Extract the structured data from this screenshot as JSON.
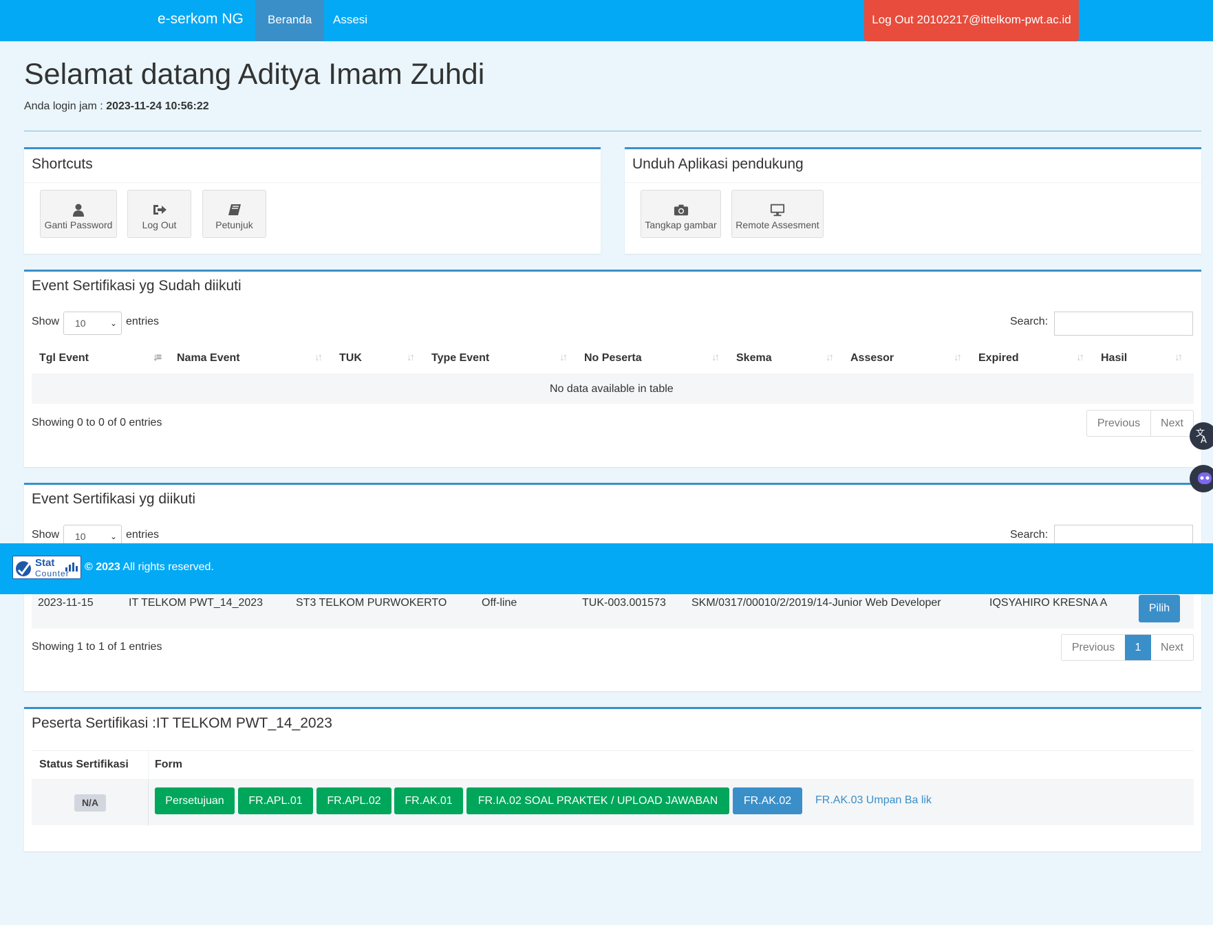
{
  "navbar": {
    "brand": "e-serkom NG",
    "links": [
      "Beranda",
      "Assesi"
    ],
    "logout": "Log Out 20102217@ittelkom-pwt.ac.id"
  },
  "header": {
    "welcome": "Selamat datang Aditya Imam Zuhdi",
    "login_label": "Anda login jam : ",
    "login_time": "2023-11-24 10:56:22"
  },
  "shortcuts": {
    "title": "Shortcuts",
    "buttons": [
      {
        "label": "Ganti Password",
        "icon": "user-icon"
      },
      {
        "label": "Log Out",
        "icon": "sign-out-icon"
      },
      {
        "label": "Petunjuk",
        "icon": "book-icon"
      }
    ]
  },
  "downloads": {
    "title": "Unduh Aplikasi pendukung",
    "buttons": [
      {
        "label": "Tangkap gambar",
        "icon": "camera-icon"
      },
      {
        "label": "Remote Assesment",
        "icon": "desktop-icon"
      }
    ]
  },
  "completed_events": {
    "title": "Event Sertifikasi yg Sudah diikuti",
    "show_label": "Show",
    "entries_value": "10",
    "entries_label": "entries",
    "search_label": "Search:",
    "columns": [
      "Tgl Event",
      "Nama Event",
      "TUK",
      "Type Event",
      "No Peserta",
      "Skema",
      "Assesor",
      "Expired",
      "Hasil"
    ],
    "empty_message": "No data available in table",
    "info": "Showing 0 to 0 of 0 entries",
    "prev": "Previous",
    "next": "Next"
  },
  "events": {
    "title": "Event Sertifikasi yg diikuti",
    "show_label": "Show",
    "entries_value": "10",
    "entries_label": "entries",
    "search_label": "Search:",
    "rows": [
      {
        "tgl": "2023-11-15",
        "nama": "IT TELKOM PWT_14_2023",
        "tuk": "ST3 TELKOM PURWOKERTO",
        "type": "Off-line",
        "no_peserta": "TUK-003.001573",
        "skema": "SKM/0317/00010/2/2019/14-Junior Web Developer",
        "assesor": "IQSYAHIRO KRESNA A",
        "action": "Pilih"
      }
    ],
    "info": "Showing 1 to 1 of 1 entries",
    "prev": "Previous",
    "page": "1",
    "next": "Next"
  },
  "footer": {
    "logo_text_top": "Stat",
    "logo_text_bottom": "Counter",
    "year": "© 2023",
    "rights": " All rights reserved."
  },
  "participant": {
    "title": "Peserta Sertifikasi :IT TELKOM PWT_14_2023",
    "col_status": "Status Sertifikasi",
    "col_form": "Form",
    "status": "N/A",
    "forms": [
      "Persetujuan",
      "FR.APL.01",
      "FR.APL.02",
      "FR.AK.01",
      "FR.IA.02 SOAL PRAKTEK / UPLOAD JAWABAN",
      "FR.AK.02"
    ],
    "link": "FR.AK.03 Umpan Ba lik"
  }
}
